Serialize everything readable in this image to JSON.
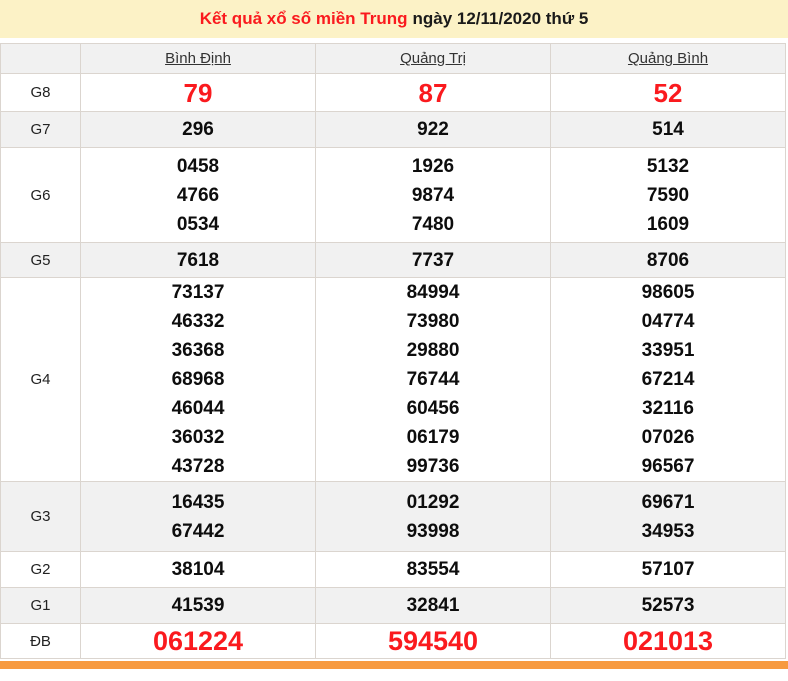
{
  "title": {
    "highlight": "Kết quả xổ số miền Trung",
    "date_part": "ngày 12/11/2020 thứ 5"
  },
  "table": {
    "columns": [
      "Bình Định",
      "Quảng Trị",
      "Quảng Bình"
    ],
    "rows": [
      {
        "label": "G8",
        "emphasis": "red",
        "values": [
          [
            "79"
          ],
          [
            "87"
          ],
          [
            "52"
          ]
        ]
      },
      {
        "label": "G7",
        "emphasis": "none",
        "values": [
          [
            "296"
          ],
          [
            "922"
          ],
          [
            "514"
          ]
        ]
      },
      {
        "label": "G6",
        "emphasis": "none",
        "values": [
          [
            "0458",
            "4766",
            "0534"
          ],
          [
            "1926",
            "9874",
            "7480"
          ],
          [
            "5132",
            "7590",
            "1609"
          ]
        ]
      },
      {
        "label": "G5",
        "emphasis": "none",
        "values": [
          [
            "7618"
          ],
          [
            "7737"
          ],
          [
            "8706"
          ]
        ]
      },
      {
        "label": "G4",
        "emphasis": "none",
        "values": [
          [
            "73137",
            "46332",
            "36368",
            "68968",
            "46044",
            "36032",
            "43728"
          ],
          [
            "84994",
            "73980",
            "29880",
            "76744",
            "60456",
            "06179",
            "99736"
          ],
          [
            "98605",
            "04774",
            "33951",
            "67214",
            "32116",
            "07026",
            "96567"
          ]
        ]
      },
      {
        "label": "G3",
        "emphasis": "none",
        "values": [
          [
            "16435",
            "67442"
          ],
          [
            "01292",
            "93998"
          ],
          [
            "69671",
            "34953"
          ]
        ]
      },
      {
        "label": "G2",
        "emphasis": "none",
        "values": [
          [
            "38104"
          ],
          [
            "83554"
          ],
          [
            "57107"
          ]
        ]
      },
      {
        "label": "G1",
        "emphasis": "none",
        "values": [
          [
            "41539"
          ],
          [
            "32841"
          ],
          [
            "52573"
          ]
        ]
      },
      {
        "label": "ĐB",
        "emphasis": "red",
        "values": [
          [
            "061224"
          ],
          [
            "594540"
          ],
          [
            "021013"
          ]
        ]
      }
    ]
  },
  "colors": {
    "title_background": "#FCF2C6",
    "accent_red": "#FA1A1E",
    "shaded_row": "#F1F1F1",
    "border": "#DBD5CF",
    "bottom_bar_orange": "#F79A40"
  }
}
